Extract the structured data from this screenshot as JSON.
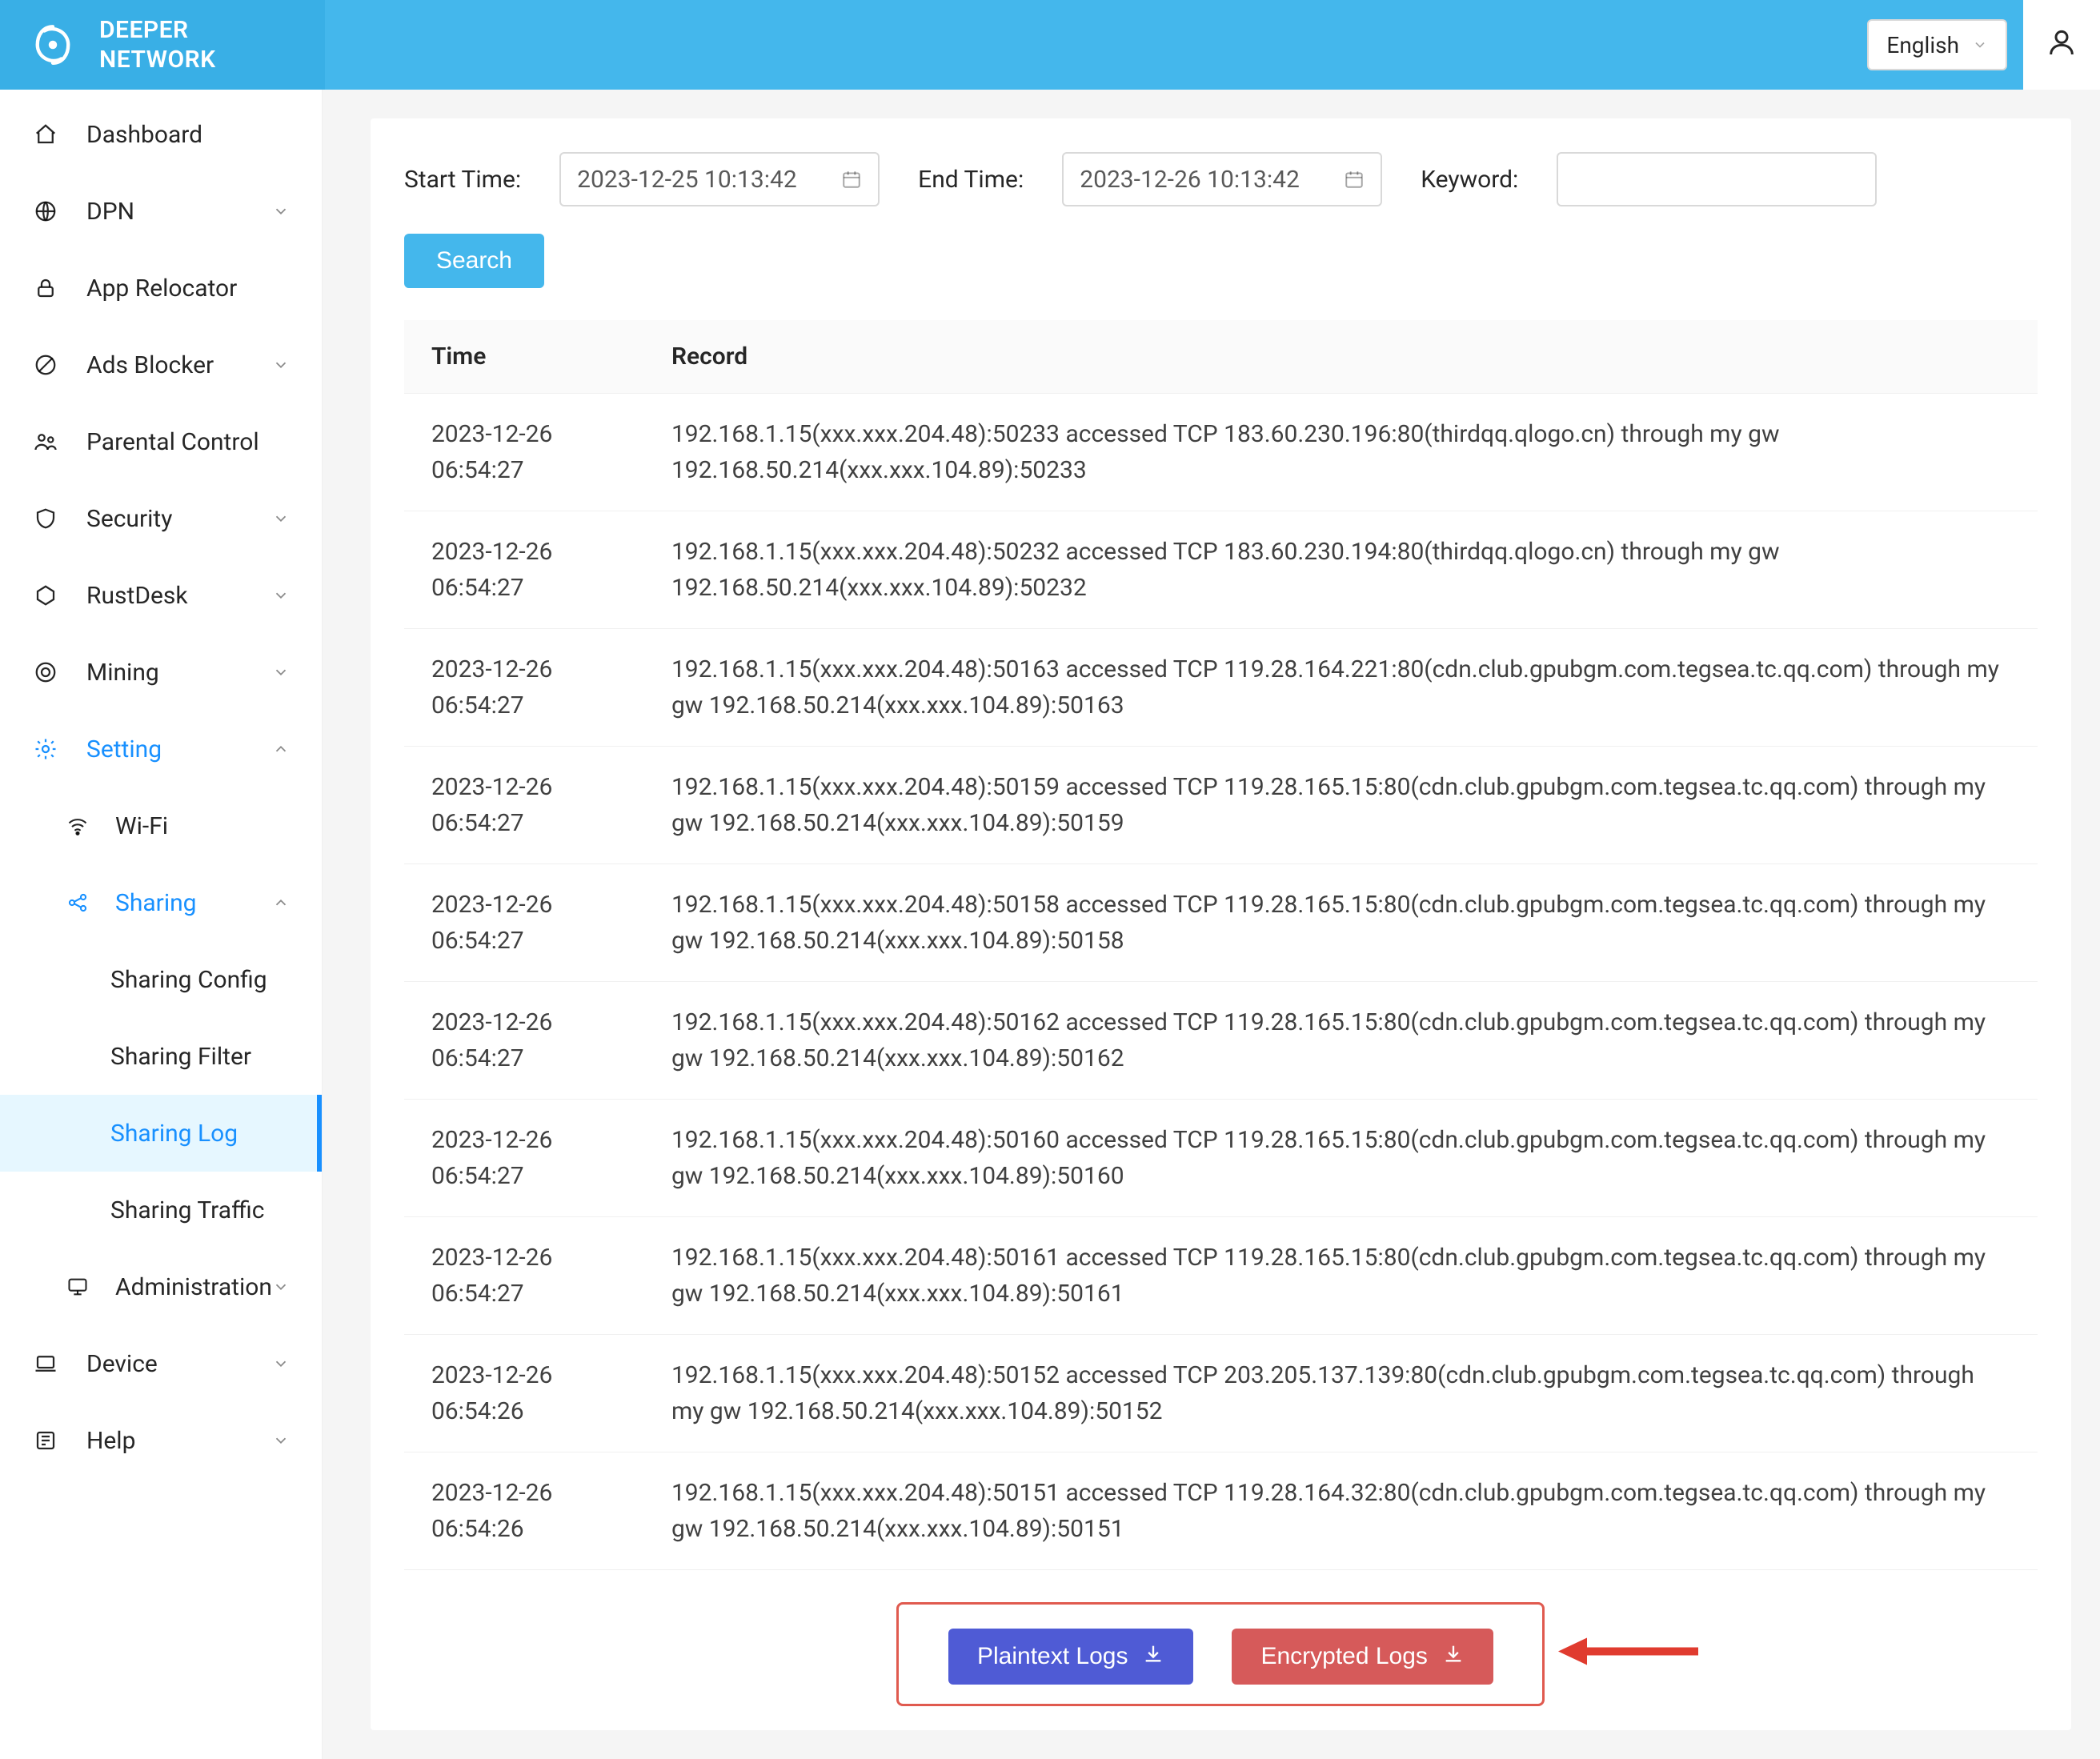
{
  "brand": {
    "line1": "DEEPER",
    "line2": "NETWORK"
  },
  "header": {
    "language": "English"
  },
  "sidebar": {
    "dashboard": "Dashboard",
    "dpn": "DPN",
    "app_relocator": "App Relocator",
    "ads_blocker": "Ads Blocker",
    "parental_control": "Parental Control",
    "security": "Security",
    "rustdesk": "RustDesk",
    "mining": "Mining",
    "setting": "Setting",
    "wifi": "Wi-Fi",
    "sharing": "Sharing",
    "sharing_config": "Sharing Config",
    "sharing_filter": "Sharing Filter",
    "sharing_log": "Sharing Log",
    "sharing_traffic": "Sharing Traffic",
    "administration": "Administration",
    "device": "Device",
    "help": "Help"
  },
  "filters": {
    "start_time_label": "Start Time:",
    "start_time_value": "2023-12-25 10:13:42",
    "end_time_label": "End Time:",
    "end_time_value": "2023-12-26 10:13:42",
    "keyword_label": "Keyword:",
    "keyword_value": "",
    "search": "Search"
  },
  "table": {
    "headers": {
      "time": "Time",
      "record": "Record"
    },
    "rows": [
      {
        "time": "2023-12-26\n06:54:27",
        "record": "192.168.1.15(xxx.xxx.204.48):50233 accessed TCP 183.60.230.196:80(thirdqq.qlogo.cn) through my gw 192.168.50.214(xxx.xxx.104.89):50233"
      },
      {
        "time": "2023-12-26\n06:54:27",
        "record": "192.168.1.15(xxx.xxx.204.48):50232 accessed TCP 183.60.230.194:80(thirdqq.qlogo.cn) through my gw 192.168.50.214(xxx.xxx.104.89):50232"
      },
      {
        "time": "2023-12-26\n06:54:27",
        "record": "192.168.1.15(xxx.xxx.204.48):50163 accessed TCP 119.28.164.221:80(cdn.club.gpubgm.com.tegsea.tc.qq.com) through my gw 192.168.50.214(xxx.xxx.104.89):50163"
      },
      {
        "time": "2023-12-26\n06:54:27",
        "record": "192.168.1.15(xxx.xxx.204.48):50159 accessed TCP 119.28.165.15:80(cdn.club.gpubgm.com.tegsea.tc.qq.com) through my gw 192.168.50.214(xxx.xxx.104.89):50159"
      },
      {
        "time": "2023-12-26\n06:54:27",
        "record": "192.168.1.15(xxx.xxx.204.48):50158 accessed TCP 119.28.165.15:80(cdn.club.gpubgm.com.tegsea.tc.qq.com) through my gw 192.168.50.214(xxx.xxx.104.89):50158"
      },
      {
        "time": "2023-12-26\n06:54:27",
        "record": "192.168.1.15(xxx.xxx.204.48):50162 accessed TCP 119.28.165.15:80(cdn.club.gpubgm.com.tegsea.tc.qq.com) through my gw 192.168.50.214(xxx.xxx.104.89):50162"
      },
      {
        "time": "2023-12-26\n06:54:27",
        "record": "192.168.1.15(xxx.xxx.204.48):50160 accessed TCP 119.28.165.15:80(cdn.club.gpubgm.com.tegsea.tc.qq.com) through my gw 192.168.50.214(xxx.xxx.104.89):50160"
      },
      {
        "time": "2023-12-26\n06:54:27",
        "record": "192.168.1.15(xxx.xxx.204.48):50161 accessed TCP 119.28.165.15:80(cdn.club.gpubgm.com.tegsea.tc.qq.com) through my gw 192.168.50.214(xxx.xxx.104.89):50161"
      },
      {
        "time": "2023-12-26\n06:54:26",
        "record": "192.168.1.15(xxx.xxx.204.48):50152 accessed TCP 203.205.137.139:80(cdn.club.gpubgm.com.tegsea.tc.qq.com) through my gw 192.168.50.214(xxx.xxx.104.89):50152"
      },
      {
        "time": "2023-12-26\n06:54:26",
        "record": "192.168.1.15(xxx.xxx.204.48):50151 accessed TCP 119.28.164.32:80(cdn.club.gpubgm.com.tegsea.tc.qq.com) through my gw 192.168.50.214(xxx.xxx.104.89):50151"
      }
    ]
  },
  "buttons": {
    "plaintext_logs": "Plaintext Logs",
    "encrypted_logs": "Encrypted Logs"
  }
}
